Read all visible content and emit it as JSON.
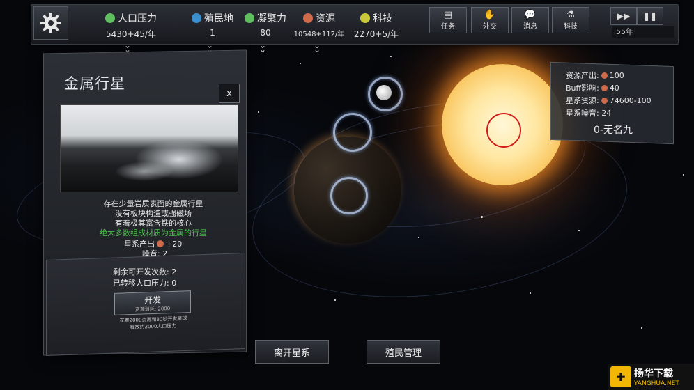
{
  "topbar": {
    "stats": [
      {
        "label": "人口压力",
        "value": "5430+45/年",
        "icon": "population-icon",
        "color": "#5fbf5f"
      },
      {
        "label": "殖民地",
        "value": "1",
        "icon": "colony-icon",
        "color": "#3a8fd0"
      },
      {
        "label": "凝聚力",
        "value": "80",
        "icon": "cohesion-icon",
        "color": "#5fbf5f"
      },
      {
        "label": "资源",
        "value": "10548+112/年",
        "icon": "resource-icon",
        "color": "#d06a4a"
      },
      {
        "label": "科技",
        "value": "2270+5/年",
        "icon": "tech-icon",
        "color": "#c8c83a"
      }
    ],
    "menu": [
      {
        "label": "任务",
        "icon": "task-icon"
      },
      {
        "label": "外交",
        "icon": "handshake-icon"
      },
      {
        "label": "消息",
        "icon": "message-icon"
      },
      {
        "label": "科技",
        "icon": "flask-icon"
      }
    ],
    "year": "55年"
  },
  "planet_panel": {
    "title": "金属行星",
    "close": "x",
    "desc1": "存在少量岩质表面的金属行星",
    "desc2": "没有板块构造或强磁场",
    "desc3": "有着极其富含铁的核心",
    "desc_green": "绝大多数组成材质为金属的行星",
    "output_label": "星系产出",
    "output_value": "+20",
    "noise": "噪音: 2",
    "remaining": "剩余可开发次数: 2",
    "transferred": "已转移人口压力: 0",
    "develop_label": "开发",
    "develop_cost": "资源消耗: 2000",
    "note1": "花费2000资源和30秒开发星球",
    "note2": "释放约2000人口压力"
  },
  "system_info": {
    "output": "资源产出: ",
    "output_value": "100",
    "buff": "Buff影响: ",
    "buff_value": "40",
    "reserves": "星系资源: ",
    "reserves_value": "74600-100",
    "noise": "星系噪音: 24",
    "name": "0-无名九"
  },
  "bottom": {
    "leave": "离开星系",
    "colony": "殖民管理"
  },
  "watermark": {
    "brand": "扬华下载",
    "url": "YANGHUA.NET"
  }
}
